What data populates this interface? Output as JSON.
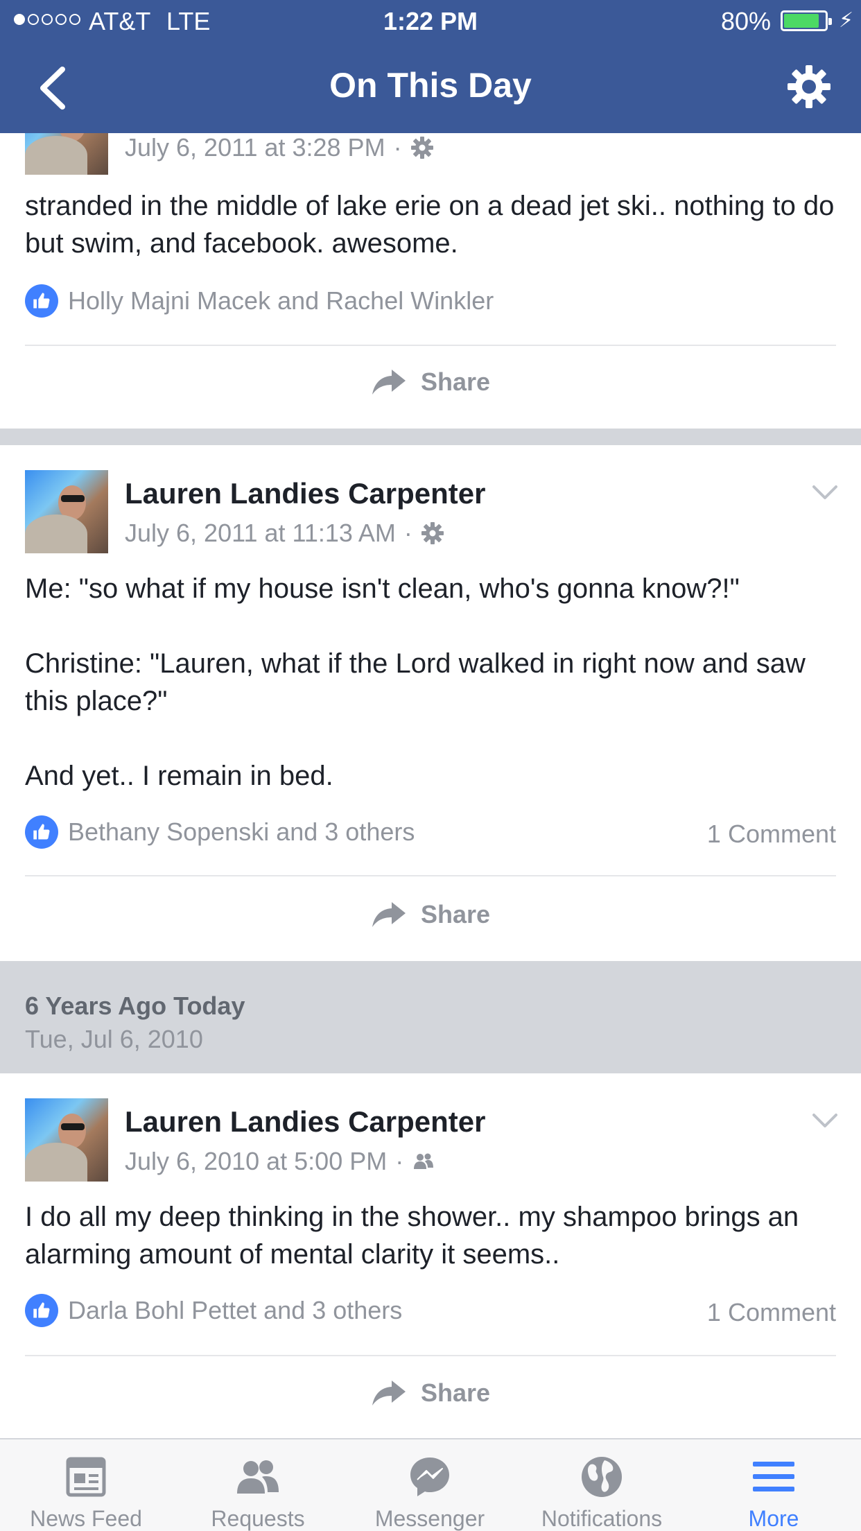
{
  "status_bar": {
    "carrier": "AT&T",
    "network": "LTE",
    "time": "1:22 PM",
    "battery": "80%",
    "battery_level": 0.8,
    "signal_bars_filled": 1,
    "signal_bars_total": 5
  },
  "nav": {
    "title": "On This Day",
    "back_icon": "chevron-left-icon",
    "settings_icon": "gear-icon"
  },
  "posts": [
    {
      "timestamp": "July 6, 2011 at 3:28 PM",
      "privacy_icon": "gear-icon",
      "text": "stranded in the middle of lake erie on a dead jet ski.. nothing to do but swim, and facebook. awesome.",
      "likes": "Holly Majni Macek and Rachel Winkler",
      "share_label": "Share"
    },
    {
      "author": "Lauren Landies Carpenter",
      "timestamp": "July 6, 2011 at 11:13 AM",
      "privacy_icon": "gear-icon",
      "text": "Me: \"so what if my house isn't clean, who's gonna know?!\"\n\nChristine: \"Lauren, what if the Lord walked in right now and saw this place?\"\n\nAnd yet.. I remain in bed.",
      "likes": "Bethany Sopenski and 3 others",
      "comments": "1 Comment",
      "share_label": "Share"
    },
    {
      "author": "Lauren Landies Carpenter",
      "timestamp": "July 6, 2010 at 5:00 PM",
      "privacy_icon": "friends-icon",
      "text": "I do all my deep thinking in the shower.. my shampoo brings an alarming amount of mental clarity it seems..",
      "likes": "Darla Bohl Pettet and 3 others",
      "comments": "1 Comment",
      "share_label": "Share"
    }
  ],
  "section": {
    "heading": "6 Years Ago Today",
    "date": "Tue, Jul 6, 2010"
  },
  "tabs": [
    {
      "label": "News Feed",
      "icon": "news-feed-icon"
    },
    {
      "label": "Requests",
      "icon": "friend-requests-icon"
    },
    {
      "label": "Messenger",
      "icon": "messenger-icon"
    },
    {
      "label": "Notifications",
      "icon": "globe-icon"
    },
    {
      "label": "More",
      "icon": "menu-icon",
      "active": true
    }
  ],
  "colors": {
    "brand": "#3b5998",
    "like_blue": "#4080ff",
    "meta_gray": "#90949c",
    "separator": "#d3d6db"
  }
}
